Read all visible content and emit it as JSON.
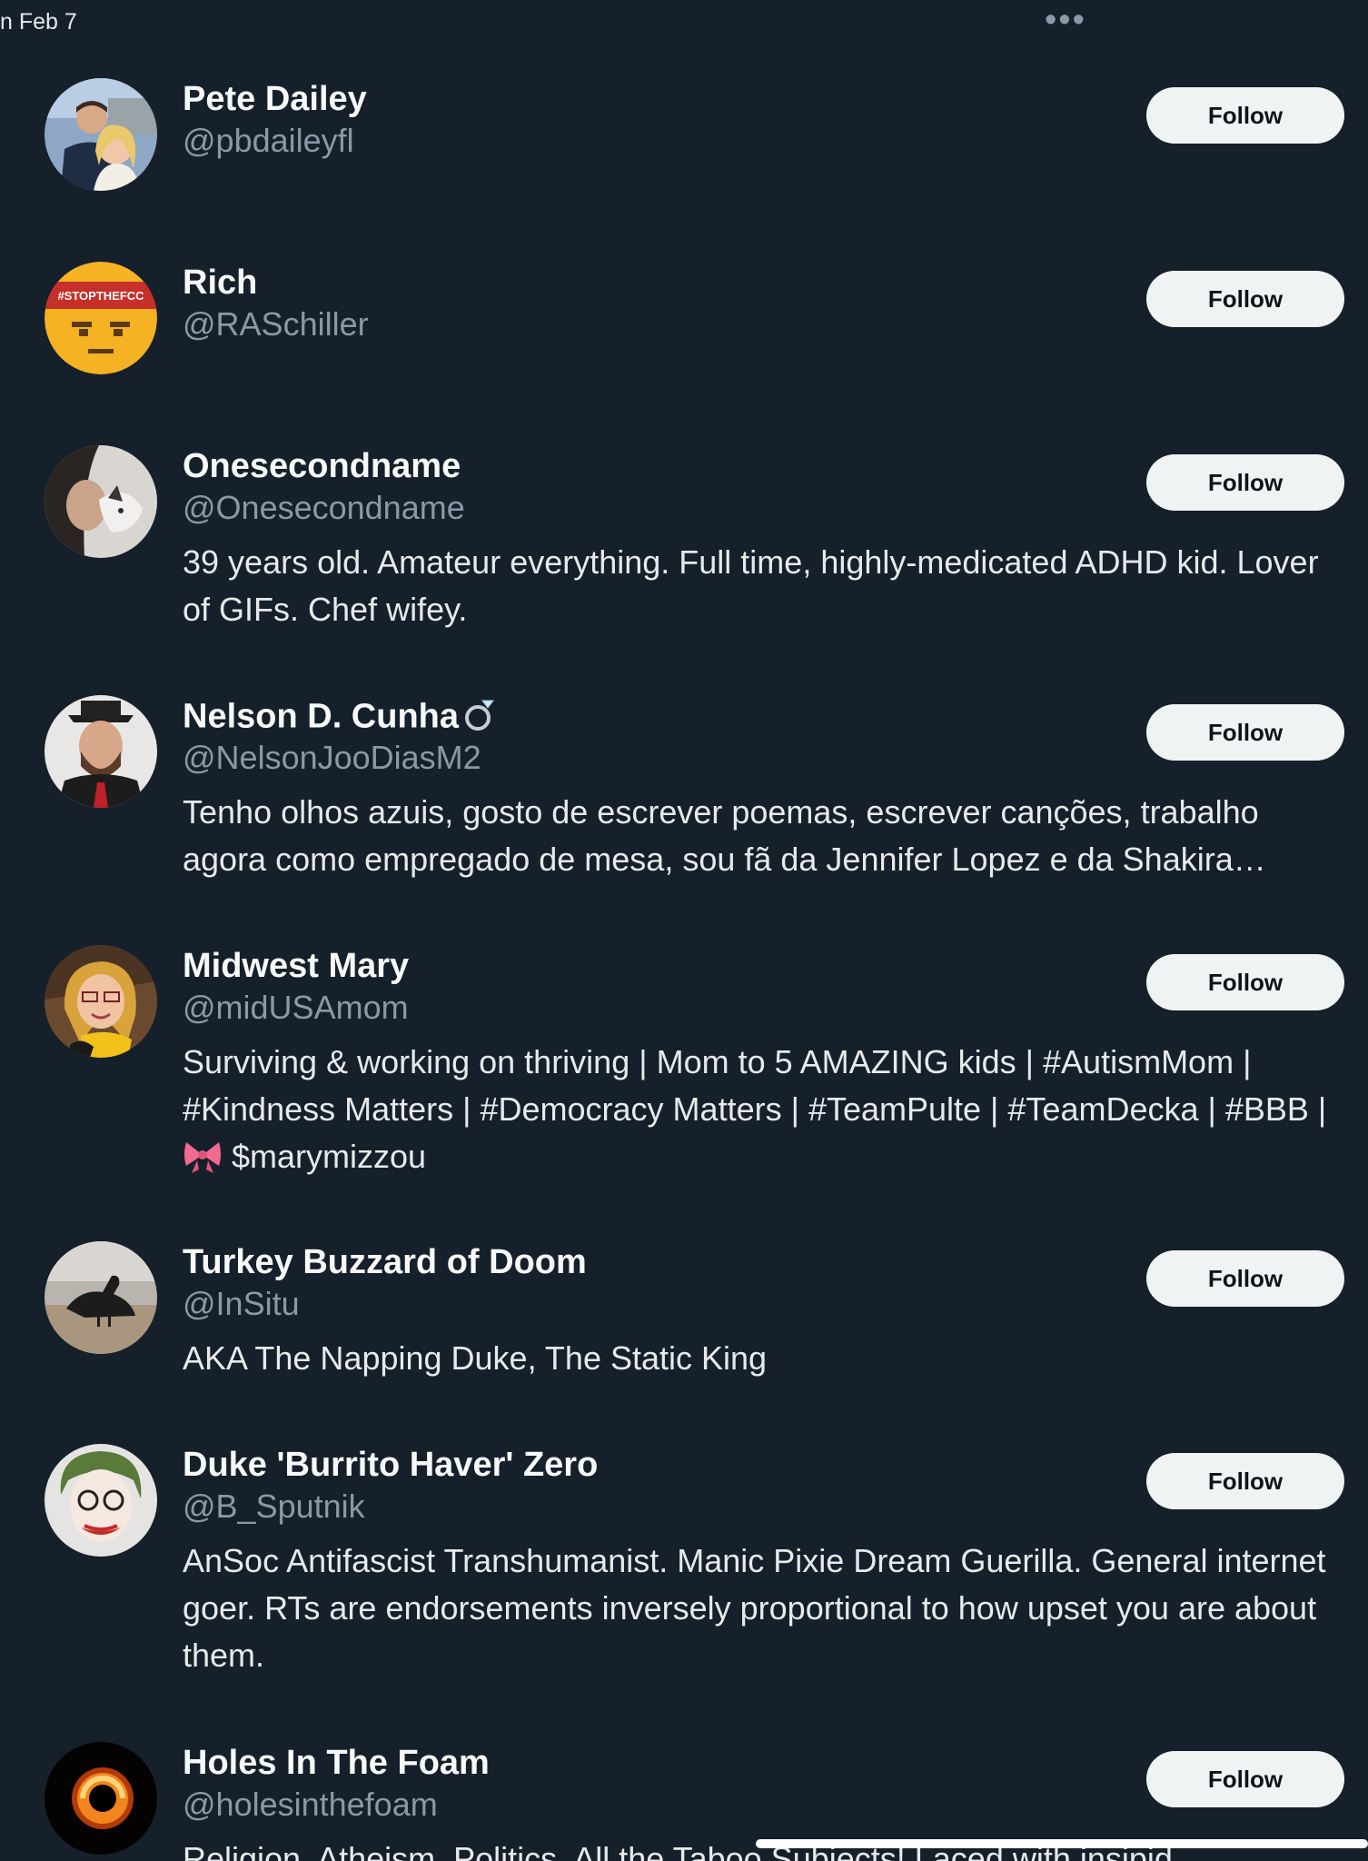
{
  "topbar": {
    "date": "n Feb 7",
    "more_label": "•••"
  },
  "follow_label": "Follow",
  "users": [
    {
      "name": "Pete Dailey",
      "handle": "@pbdaileyfl",
      "bio": ""
    },
    {
      "name": "Rich",
      "handle": "@RASchiller",
      "bio": ""
    },
    {
      "name": "Onesecondname",
      "handle": "@Onesecondname",
      "bio": "39 years old. Amateur everything. Full time, highly-medicated ADHD kid. Lover of GIFs. Chef wifey."
    },
    {
      "name": "Nelson D. Cunha",
      "handle": "@NelsonJooDiasM2",
      "bio": "Tenho olhos azuis, gosto de escrever poemas, escrever canções, trabalho agora como empregado de mesa, sou fã da Jennifer Lopez e da Shakira…"
    },
    {
      "name": "Midwest Mary",
      "handle": "@midUSAmom",
      "bio_part1": "Surviving & working on thriving | Mom to 5 AMAZING kids | #AutismMom | #Kindness Matters | #Democracy Matters | #TeamPulte | #TeamDecka | #BBB |",
      "bio_part2": "$marymizzou"
    },
    {
      "name": "Turkey Buzzard of Doom",
      "handle": "@InSitu",
      "bio": "AKA The Napping Duke, The Static King"
    },
    {
      "name": "Duke 'Burrito Haver' Zero",
      "handle": "@B_Sputnik",
      "bio": "AnSoc Antifascist Transhumanist. Manic Pixie Dream Guerilla. General internet goer. RTs are endorsements inversely proportional to how upset you are about them."
    },
    {
      "name": "Holes In The Foam",
      "handle": "@holesinthefoam",
      "bio": "Religion, Atheism, Politics, All the Taboo Subjects! Laced with insipid"
    }
  ],
  "avatar_text": {
    "rich_banner": "#STOPTHEFCC"
  },
  "colors": {
    "background": "#15202b",
    "button_bg": "#eff3f4",
    "secondary_text": "#8b98a5"
  }
}
